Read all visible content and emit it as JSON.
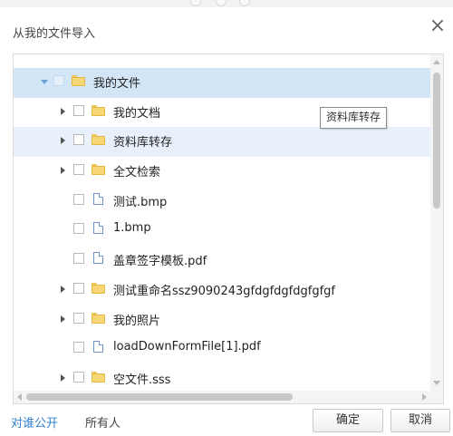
{
  "dialog": {
    "title": "从我的文件导入",
    "close_icon": "×"
  },
  "tree": {
    "tooltip": "资料库转存",
    "items": [
      {
        "label": "我的文件",
        "type": "folder",
        "level": 0,
        "expander": "expanded",
        "state": "selected"
      },
      {
        "label": "我的文档",
        "type": "folder",
        "level": 1,
        "expander": "collapsed",
        "state": ""
      },
      {
        "label": "资料库转存",
        "type": "folder",
        "level": 1,
        "expander": "collapsed",
        "state": "hover"
      },
      {
        "label": "全文检索",
        "type": "folder",
        "level": 1,
        "expander": "collapsed",
        "state": ""
      },
      {
        "label": "测试.bmp",
        "type": "file",
        "level": 1,
        "expander": "none",
        "state": ""
      },
      {
        "label": "1.bmp",
        "type": "file",
        "level": 1,
        "expander": "none",
        "state": ""
      },
      {
        "label": "盖章签字模板.pdf",
        "type": "file",
        "level": 1,
        "expander": "none",
        "state": ""
      },
      {
        "label": "测试重命名ssz9090243gfdgfdgfdgfgfgf",
        "type": "folder",
        "level": 1,
        "expander": "collapsed",
        "state": ""
      },
      {
        "label": "我的照片",
        "type": "folder",
        "level": 1,
        "expander": "collapsed",
        "state": ""
      },
      {
        "label": "loadDownFormFile[1].pdf",
        "type": "file",
        "level": 1,
        "expander": "none",
        "state": ""
      },
      {
        "label": "空文件.sss",
        "type": "folder",
        "level": 1,
        "expander": "collapsed",
        "state": ""
      }
    ]
  },
  "footer": {
    "share_link": "对谁公开",
    "share_value": "所有人",
    "ok_label": "确定",
    "cancel_label": "取消"
  },
  "colors": {
    "selected_row": "#d3e6f7",
    "hover_row": "#e8f1fb",
    "link": "#2f7fd0",
    "folder": "#f7d675",
    "file_outline": "#6f95c8"
  }
}
